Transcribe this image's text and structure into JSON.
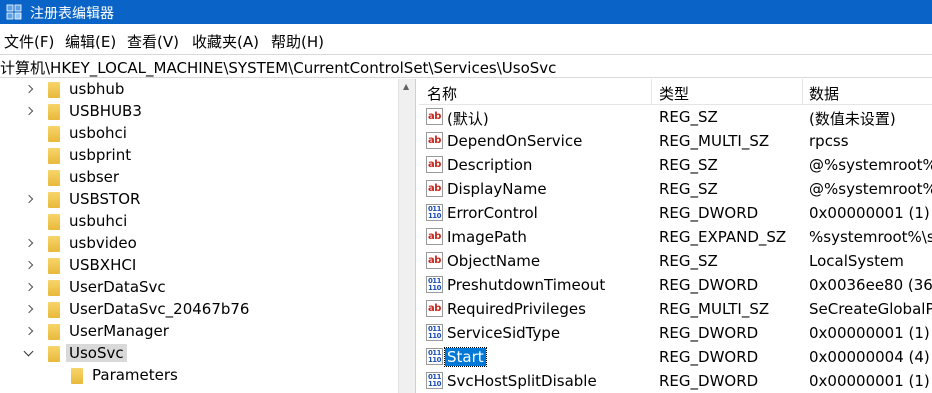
{
  "window": {
    "title": "注册表编辑器",
    "title_bar_color": "#0a64c8"
  },
  "menu": [
    "文件(F)",
    "编辑(E)",
    "查看(V)",
    "收藏夹(A)",
    "帮助(H)"
  ],
  "address": "计算机\\HKEY_LOCAL_MACHINE\\SYSTEM\\CurrentControlSet\\Services\\UsoSvc",
  "tree": {
    "items": [
      {
        "label": "usbhub",
        "expander": "collapsed",
        "selected": false,
        "level": 0
      },
      {
        "label": "USBHUB3",
        "expander": "collapsed",
        "selected": false,
        "level": 0
      },
      {
        "label": "usbohci",
        "expander": "none",
        "selected": false,
        "level": 0
      },
      {
        "label": "usbprint",
        "expander": "none",
        "selected": false,
        "level": 0
      },
      {
        "label": "usbser",
        "expander": "none",
        "selected": false,
        "level": 0
      },
      {
        "label": "USBSTOR",
        "expander": "collapsed",
        "selected": false,
        "level": 0
      },
      {
        "label": "usbuhci",
        "expander": "none",
        "selected": false,
        "level": 0
      },
      {
        "label": "usbvideo",
        "expander": "collapsed",
        "selected": false,
        "level": 0
      },
      {
        "label": "USBXHCI",
        "expander": "collapsed",
        "selected": false,
        "level": 0
      },
      {
        "label": "UserDataSvc",
        "expander": "collapsed",
        "selected": false,
        "level": 0
      },
      {
        "label": "UserDataSvc_20467b76",
        "expander": "collapsed",
        "selected": false,
        "level": 0
      },
      {
        "label": "UserManager",
        "expander": "collapsed",
        "selected": false,
        "level": 0
      },
      {
        "label": "UsoSvc",
        "expander": "expanded",
        "selected": true,
        "level": 0
      },
      {
        "label": "Parameters",
        "expander": "none",
        "selected": false,
        "level": 1
      }
    ]
  },
  "list": {
    "headers": {
      "name": "名称",
      "type": "类型",
      "data": "数据"
    },
    "rows": [
      {
        "icon": "string-value-icon",
        "name": "(默认)",
        "type": "REG_SZ",
        "data": "(数值未设置)",
        "selected": false
      },
      {
        "icon": "string-value-icon",
        "name": "DependOnService",
        "type": "REG_MULTI_SZ",
        "data": "rpcss",
        "selected": false
      },
      {
        "icon": "string-value-icon",
        "name": "Description",
        "type": "REG_SZ",
        "data": "@%systemroot%",
        "selected": false
      },
      {
        "icon": "string-value-icon",
        "name": "DisplayName",
        "type": "REG_SZ",
        "data": "@%systemroot%",
        "selected": false
      },
      {
        "icon": "binary-value-icon",
        "name": "ErrorControl",
        "type": "REG_DWORD",
        "data": "0x00000001 (1)",
        "selected": false
      },
      {
        "icon": "string-value-icon",
        "name": "ImagePath",
        "type": "REG_EXPAND_SZ",
        "data": "%systemroot%\\s",
        "selected": false
      },
      {
        "icon": "string-value-icon",
        "name": "ObjectName",
        "type": "REG_SZ",
        "data": "LocalSystem",
        "selected": false
      },
      {
        "icon": "binary-value-icon",
        "name": "PreshutdownTimeout",
        "type": "REG_DWORD",
        "data": "0x0036ee80 (360",
        "selected": false
      },
      {
        "icon": "string-value-icon",
        "name": "RequiredPrivileges",
        "type": "REG_MULTI_SZ",
        "data": "SeCreateGlobalP",
        "selected": false
      },
      {
        "icon": "binary-value-icon",
        "name": "ServiceSidType",
        "type": "REG_DWORD",
        "data": "0x00000001 (1)",
        "selected": false
      },
      {
        "icon": "binary-value-icon",
        "name": "Start",
        "type": "REG_DWORD",
        "data": "0x00000004 (4)",
        "selected": true
      },
      {
        "icon": "binary-value-icon",
        "name": "SvcHostSplitDisable",
        "type": "REG_DWORD",
        "data": "0x00000001 (1)",
        "selected": false
      }
    ]
  },
  "colors": {
    "selection": "#0078d7",
    "tree_selection": "#d9d9d9"
  }
}
